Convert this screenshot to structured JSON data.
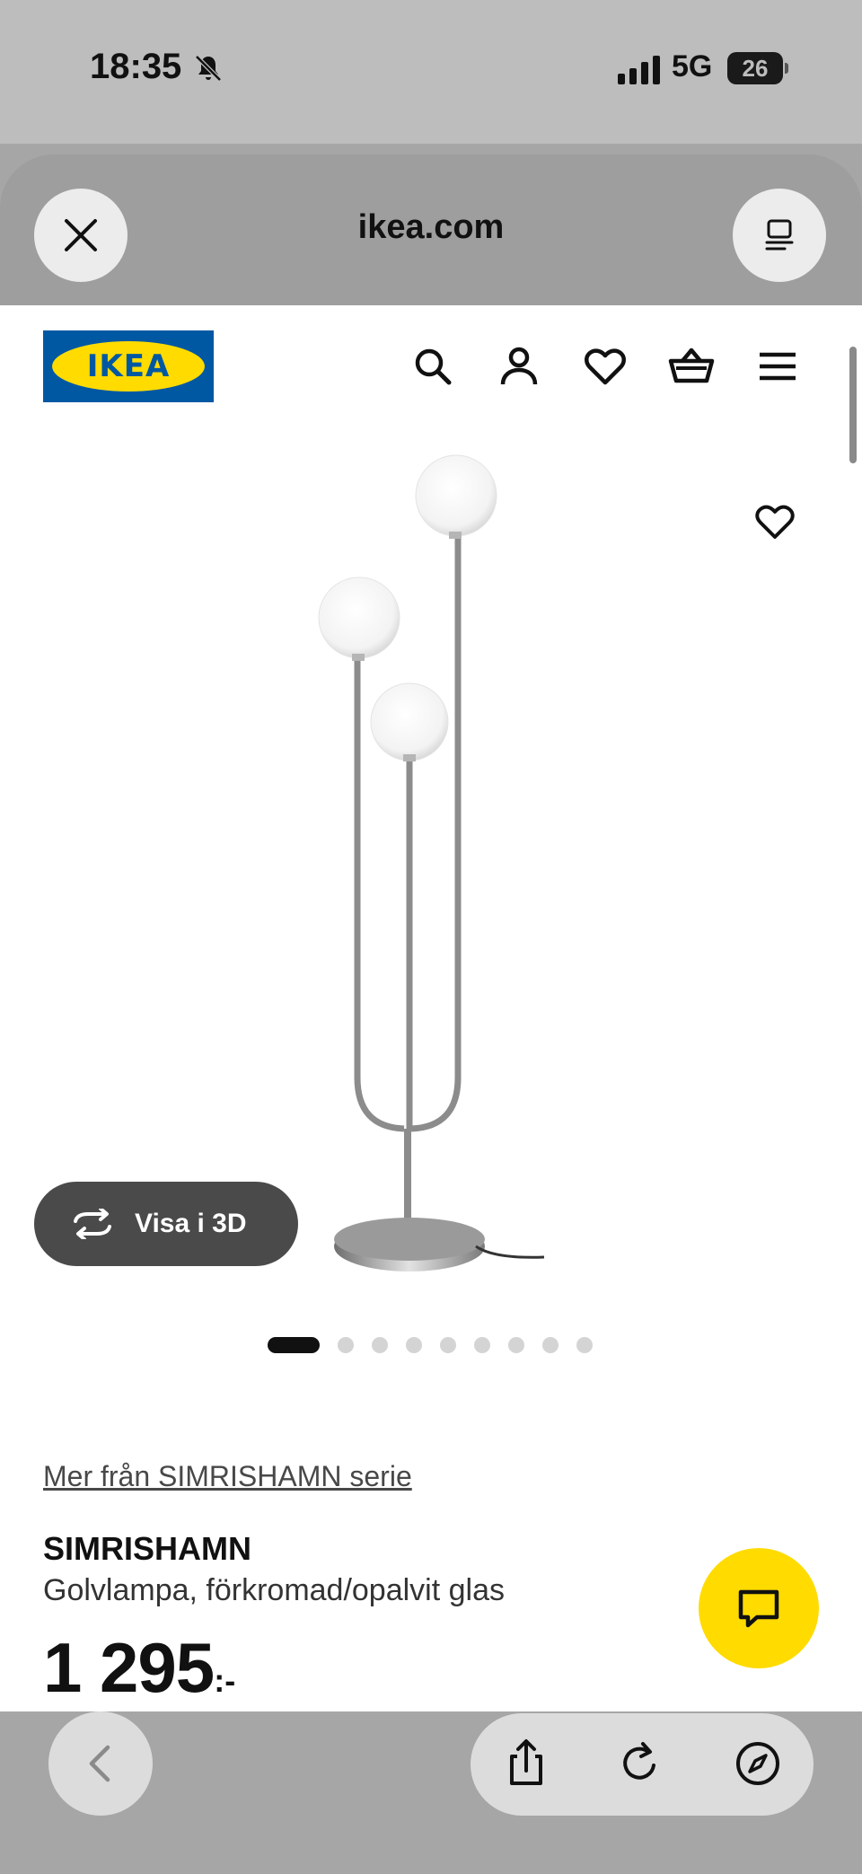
{
  "status_bar": {
    "time": "18:35",
    "network": "5G",
    "battery": "26"
  },
  "browser": {
    "domain": "ikea.com"
  },
  "site": {
    "logo_text": "IKEA"
  },
  "product": {
    "view_3d_label": "Visa i 3D",
    "image_count": 9,
    "active_image": 1,
    "series_link": "Mer från SIMRISHAMN serie",
    "name": "SIMRISHAMN",
    "description": "Golvlampa, förkromad/opalvit glas",
    "price": "1 295",
    "price_suffix": ":-"
  },
  "icons": {
    "status": [
      "silent-bell-icon",
      "signal-icon",
      "battery-icon"
    ],
    "browser": [
      "close-icon",
      "tabs-icon"
    ],
    "header": [
      "search-icon",
      "account-icon",
      "heart-icon",
      "basket-icon",
      "menu-icon"
    ],
    "product": [
      "favourite-icon",
      "rotate-3d-icon",
      "chat-icon"
    ],
    "bottom": [
      "back-icon",
      "share-icon",
      "reload-icon",
      "compass-icon"
    ]
  },
  "colors": {
    "brand_blue": "#0058a3",
    "brand_yellow": "#ffdb00"
  }
}
